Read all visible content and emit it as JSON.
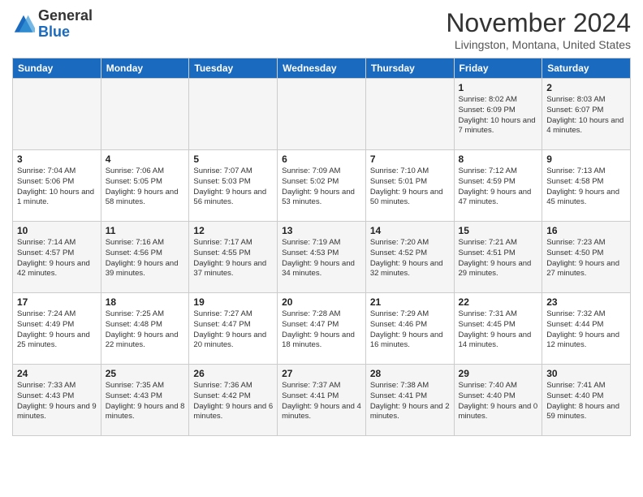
{
  "logo": {
    "general": "General",
    "blue": "Blue"
  },
  "header": {
    "month": "November 2024",
    "location": "Livingston, Montana, United States"
  },
  "weekdays": [
    "Sunday",
    "Monday",
    "Tuesday",
    "Wednesday",
    "Thursday",
    "Friday",
    "Saturday"
  ],
  "weeks": [
    [
      {
        "day": "",
        "info": ""
      },
      {
        "day": "",
        "info": ""
      },
      {
        "day": "",
        "info": ""
      },
      {
        "day": "",
        "info": ""
      },
      {
        "day": "",
        "info": ""
      },
      {
        "day": "1",
        "info": "Sunrise: 8:02 AM\nSunset: 6:09 PM\nDaylight: 10 hours and 7 minutes."
      },
      {
        "day": "2",
        "info": "Sunrise: 8:03 AM\nSunset: 6:07 PM\nDaylight: 10 hours and 4 minutes."
      }
    ],
    [
      {
        "day": "3",
        "info": "Sunrise: 7:04 AM\nSunset: 5:06 PM\nDaylight: 10 hours and 1 minute."
      },
      {
        "day": "4",
        "info": "Sunrise: 7:06 AM\nSunset: 5:05 PM\nDaylight: 9 hours and 58 minutes."
      },
      {
        "day": "5",
        "info": "Sunrise: 7:07 AM\nSunset: 5:03 PM\nDaylight: 9 hours and 56 minutes."
      },
      {
        "day": "6",
        "info": "Sunrise: 7:09 AM\nSunset: 5:02 PM\nDaylight: 9 hours and 53 minutes."
      },
      {
        "day": "7",
        "info": "Sunrise: 7:10 AM\nSunset: 5:01 PM\nDaylight: 9 hours and 50 minutes."
      },
      {
        "day": "8",
        "info": "Sunrise: 7:12 AM\nSunset: 4:59 PM\nDaylight: 9 hours and 47 minutes."
      },
      {
        "day": "9",
        "info": "Sunrise: 7:13 AM\nSunset: 4:58 PM\nDaylight: 9 hours and 45 minutes."
      }
    ],
    [
      {
        "day": "10",
        "info": "Sunrise: 7:14 AM\nSunset: 4:57 PM\nDaylight: 9 hours and 42 minutes."
      },
      {
        "day": "11",
        "info": "Sunrise: 7:16 AM\nSunset: 4:56 PM\nDaylight: 9 hours and 39 minutes."
      },
      {
        "day": "12",
        "info": "Sunrise: 7:17 AM\nSunset: 4:55 PM\nDaylight: 9 hours and 37 minutes."
      },
      {
        "day": "13",
        "info": "Sunrise: 7:19 AM\nSunset: 4:53 PM\nDaylight: 9 hours and 34 minutes."
      },
      {
        "day": "14",
        "info": "Sunrise: 7:20 AM\nSunset: 4:52 PM\nDaylight: 9 hours and 32 minutes."
      },
      {
        "day": "15",
        "info": "Sunrise: 7:21 AM\nSunset: 4:51 PM\nDaylight: 9 hours and 29 minutes."
      },
      {
        "day": "16",
        "info": "Sunrise: 7:23 AM\nSunset: 4:50 PM\nDaylight: 9 hours and 27 minutes."
      }
    ],
    [
      {
        "day": "17",
        "info": "Sunrise: 7:24 AM\nSunset: 4:49 PM\nDaylight: 9 hours and 25 minutes."
      },
      {
        "day": "18",
        "info": "Sunrise: 7:25 AM\nSunset: 4:48 PM\nDaylight: 9 hours and 22 minutes."
      },
      {
        "day": "19",
        "info": "Sunrise: 7:27 AM\nSunset: 4:47 PM\nDaylight: 9 hours and 20 minutes."
      },
      {
        "day": "20",
        "info": "Sunrise: 7:28 AM\nSunset: 4:47 PM\nDaylight: 9 hours and 18 minutes."
      },
      {
        "day": "21",
        "info": "Sunrise: 7:29 AM\nSunset: 4:46 PM\nDaylight: 9 hours and 16 minutes."
      },
      {
        "day": "22",
        "info": "Sunrise: 7:31 AM\nSunset: 4:45 PM\nDaylight: 9 hours and 14 minutes."
      },
      {
        "day": "23",
        "info": "Sunrise: 7:32 AM\nSunset: 4:44 PM\nDaylight: 9 hours and 12 minutes."
      }
    ],
    [
      {
        "day": "24",
        "info": "Sunrise: 7:33 AM\nSunset: 4:43 PM\nDaylight: 9 hours and 9 minutes."
      },
      {
        "day": "25",
        "info": "Sunrise: 7:35 AM\nSunset: 4:43 PM\nDaylight: 9 hours and 8 minutes."
      },
      {
        "day": "26",
        "info": "Sunrise: 7:36 AM\nSunset: 4:42 PM\nDaylight: 9 hours and 6 minutes."
      },
      {
        "day": "27",
        "info": "Sunrise: 7:37 AM\nSunset: 4:41 PM\nDaylight: 9 hours and 4 minutes."
      },
      {
        "day": "28",
        "info": "Sunrise: 7:38 AM\nSunset: 4:41 PM\nDaylight: 9 hours and 2 minutes."
      },
      {
        "day": "29",
        "info": "Sunrise: 7:40 AM\nSunset: 4:40 PM\nDaylight: 9 hours and 0 minutes."
      },
      {
        "day": "30",
        "info": "Sunrise: 7:41 AM\nSunset: 4:40 PM\nDaylight: 8 hours and 59 minutes."
      }
    ]
  ]
}
